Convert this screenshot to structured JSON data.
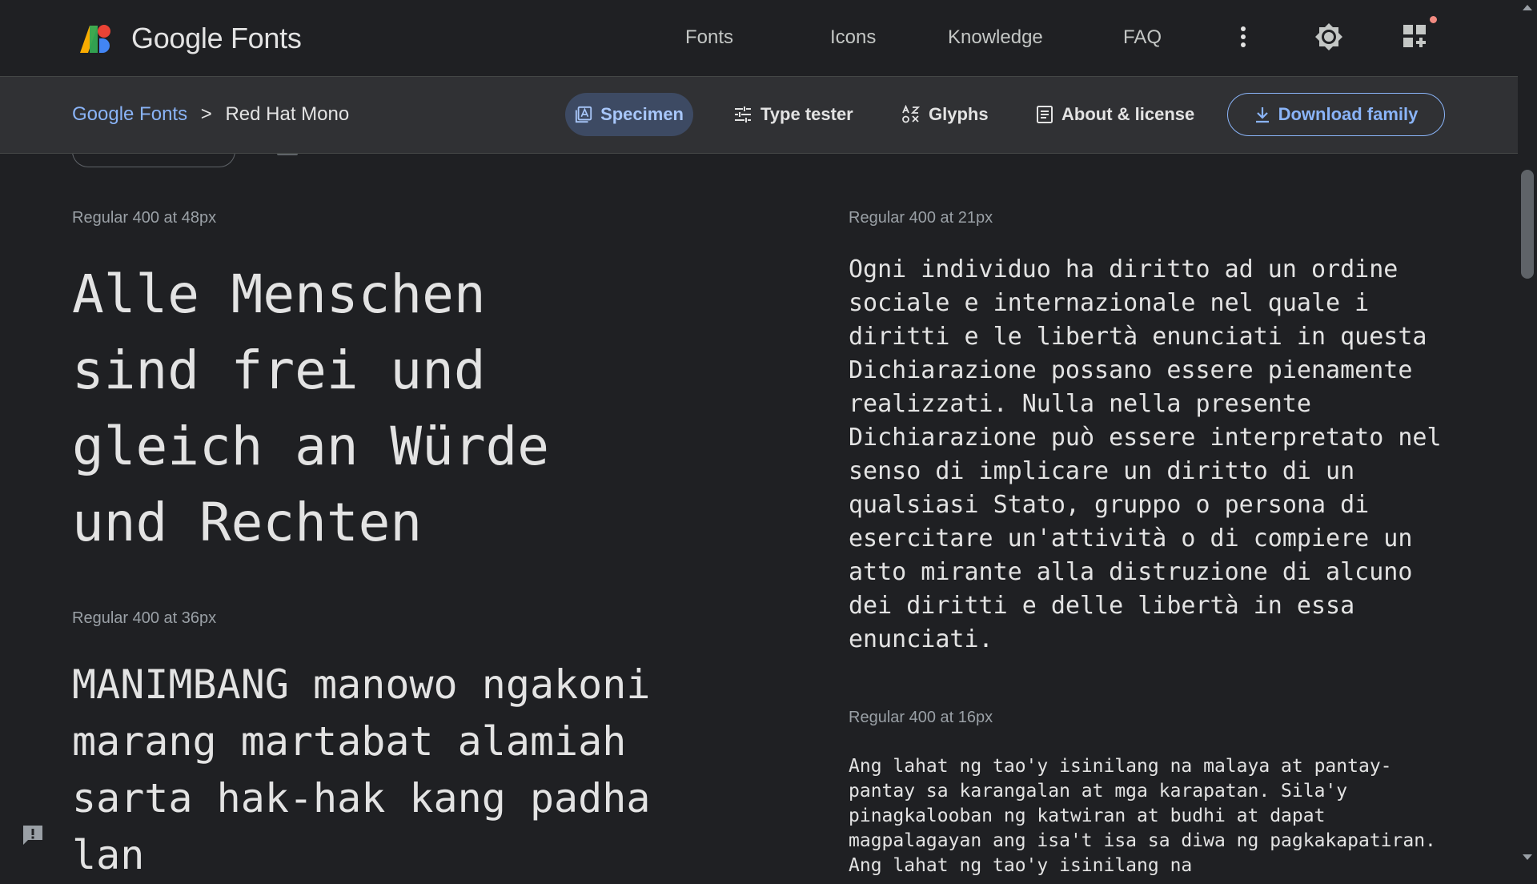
{
  "header": {
    "brand": "Google Fonts",
    "nav": [
      {
        "label": "Fonts"
      },
      {
        "label": "Icons"
      },
      {
        "label": "Knowledge"
      },
      {
        "label": "FAQ"
      }
    ],
    "icons": [
      "more-vert-icon",
      "theme-toggle-icon",
      "apps-grid-icon"
    ]
  },
  "subnav": {
    "breadcrumb_root": "Google Fonts",
    "breadcrumb_sep": ">",
    "breadcrumb_current": "Red Hat Mono",
    "tabs": [
      {
        "label": "Specimen",
        "icon": "specimen-icon",
        "active": true
      },
      {
        "label": "Type tester",
        "icon": "tune-icon",
        "active": false
      },
      {
        "label": "Glyphs",
        "icon": "glyphs-icon",
        "active": false
      },
      {
        "label": "About & license",
        "icon": "article-icon",
        "active": false
      }
    ],
    "download_label": "Download family"
  },
  "specimens": [
    {
      "label": "Regular 400 at 48px",
      "text": "Alle Menschen sind frei und gleich an Würde und Rechten"
    },
    {
      "label": "Regular 400 at 36px",
      "text": "MANIMBANG manowo ngakoni marang martabat alamiah sarta hak-hak kang padha lan"
    },
    {
      "label": "Regular 400 at 21px",
      "text": "Ogni individuo ha diritto ad un ordine sociale e internazionale nel quale i diritti e le libertà enunciati in questa Dichiarazione possano essere pienamente realizzati. Nulla nella presente Dichiarazione può essere interpretato nel senso di implicare un diritto di un qualsiasi Stato, gruppo o persona di esercitare un'attività o di compiere un atto mirante alla distruzione di alcuno dei diritti e delle libertà in essa enunciati."
    },
    {
      "label": "Regular 400 at 16px",
      "text": "Ang lahat ng tao'y isinilang na malaya at pantay-pantay sa karangalan at mga karapatan. Sila'y pinagkalooban ng katwiran at budhi at dapat magpalagayan ang isa't isa sa diwa ng pagkakapatiran. Ang lahat ng tao'y isinilang na"
    }
  ],
  "colors": {
    "background": "#1f2023",
    "subnav_background": "#303134",
    "accent": "#8ab4f8",
    "active_tab": "#3d4a63",
    "notification_dot": "#f28b82"
  }
}
